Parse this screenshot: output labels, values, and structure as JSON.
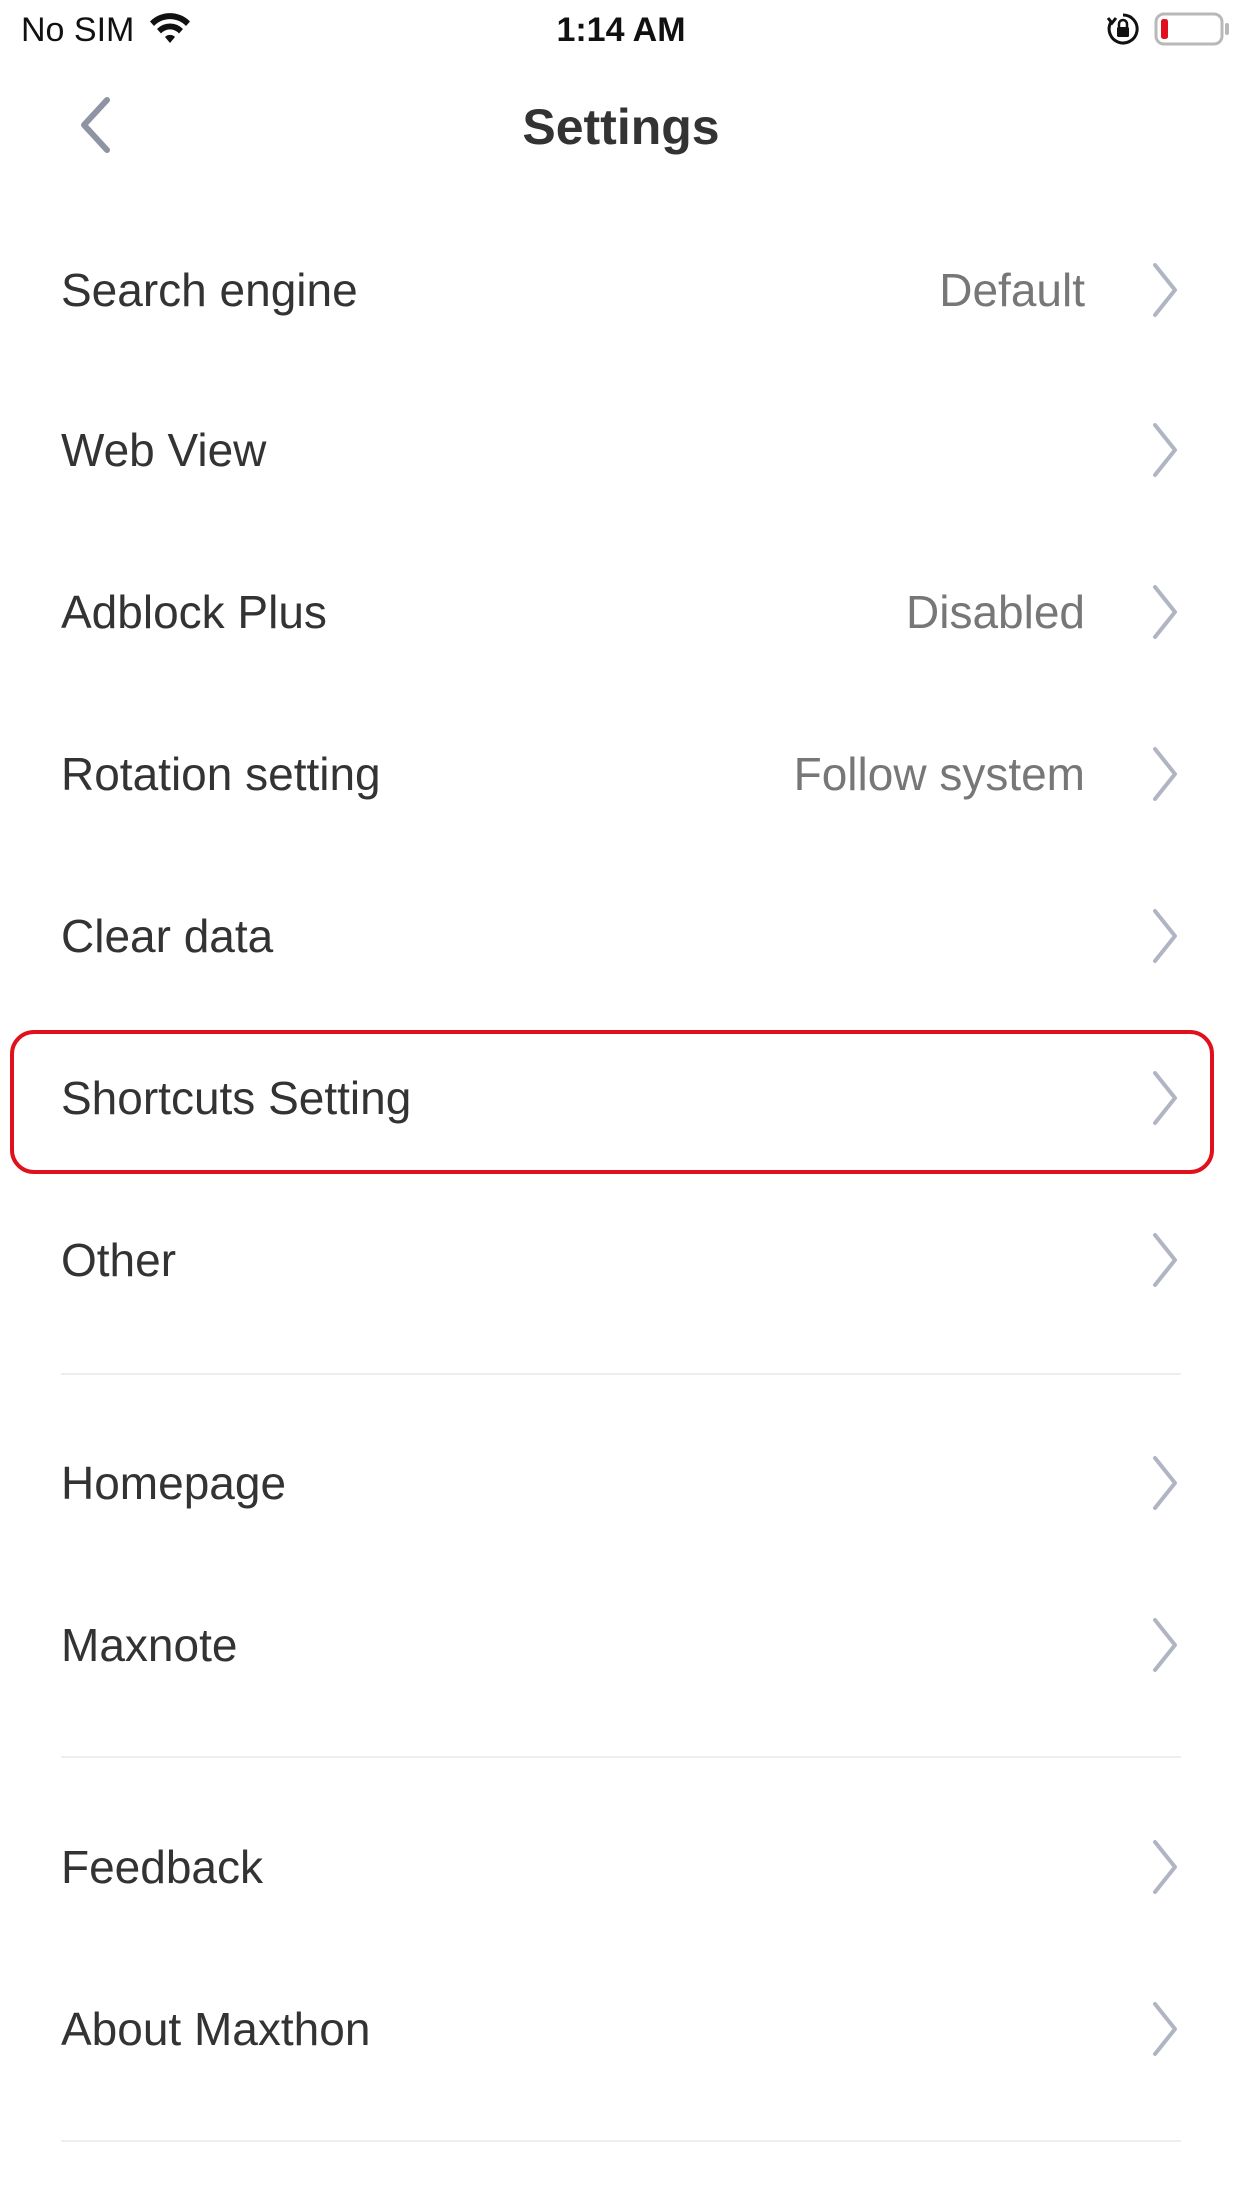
{
  "status_bar": {
    "carrier": "No SIM",
    "time": "1:14 AM",
    "icons": [
      "wifi-icon",
      "orientation-lock-icon",
      "battery-icon"
    ],
    "battery_color": "#e0101c"
  },
  "header": {
    "title": "Settings",
    "back_icon": "chevron-left-icon"
  },
  "rows": [
    {
      "label": "Search engine",
      "value": "Default"
    },
    {
      "label": "Web View",
      "value": ""
    },
    {
      "label": "Adblock Plus",
      "value": "Disabled"
    },
    {
      "label": "Rotation setting",
      "value": "Follow system"
    },
    {
      "label": "Clear data",
      "value": ""
    },
    {
      "label": "Shortcuts Setting",
      "value": "",
      "highlighted": true
    },
    {
      "label": "Other",
      "value": ""
    },
    {
      "label": "Homepage",
      "value": ""
    },
    {
      "label": "Maxnote",
      "value": ""
    },
    {
      "label": "Feedback",
      "value": ""
    },
    {
      "label": "About Maxthon",
      "value": ""
    }
  ],
  "colors": {
    "text": "#333333",
    "value_text": "#777777",
    "chevron": "#b0b5c3",
    "divider": "#eeeeee",
    "highlight": "#e0101c"
  }
}
